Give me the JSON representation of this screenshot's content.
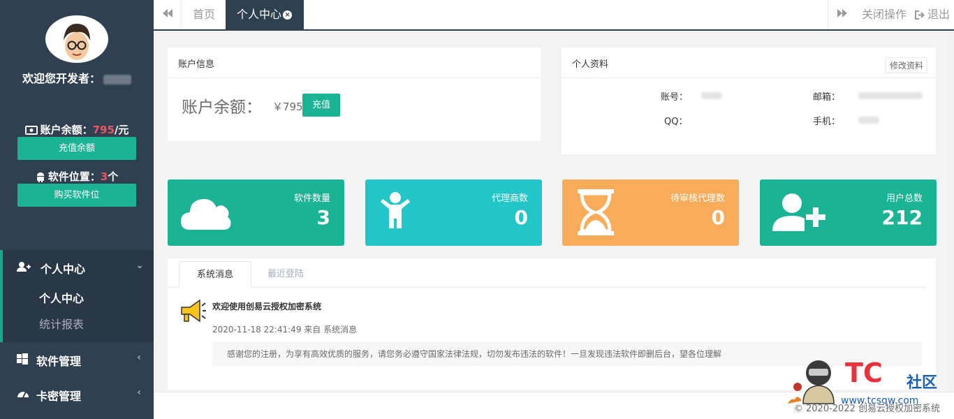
{
  "sidebar": {
    "welcome_label": "欢迎您开发者：",
    "balance": {
      "prefix": "账户余额：",
      "amount": "795",
      "suffix": "/元",
      "button": "充值余额"
    },
    "software": {
      "prefix": "软件位置：",
      "amount": "3",
      "suffix": "个",
      "button": "购买软件位"
    },
    "nav": [
      {
        "label": "个人中心",
        "icon": "user-plus-icon",
        "active": true,
        "children": [
          {
            "label": "个人中心",
            "active": true
          },
          {
            "label": "统计报表",
            "active": false
          }
        ]
      },
      {
        "label": "软件管理",
        "icon": "windows-icon"
      },
      {
        "label": "卡密管理",
        "icon": "dashboard-icon"
      }
    ]
  },
  "topbar": {
    "tabs": [
      {
        "label": "首页"
      },
      {
        "label": "个人中心",
        "active": true
      }
    ],
    "close_ops": "关闭操作",
    "logout": "退出"
  },
  "account_panel": {
    "title": "账户信息",
    "balance_label": "账户余额：",
    "balance_value": "￥795",
    "recharge": "充值"
  },
  "profile_panel": {
    "title": "个人资料",
    "edit": "修改资料",
    "fields": {
      "account": "账号：",
      "email": "邮箱：",
      "qq": "QQ：",
      "phone": "手机："
    }
  },
  "stats": [
    {
      "title": "软件数量",
      "value": "3",
      "color": "#1ab394",
      "icon": "cloud-icon"
    },
    {
      "title": "代理商数",
      "value": "0",
      "color": "#23c6c8",
      "icon": "child-icon"
    },
    {
      "title": "待审核代理数",
      "value": "0",
      "color": "#f8ac59",
      "icon": "hourglass-icon"
    },
    {
      "title": "用户总数",
      "value": "212",
      "color": "#1ab394",
      "icon": "user-add-icon"
    }
  ],
  "messages": {
    "tabs": [
      {
        "label": "系统消息",
        "active": true
      },
      {
        "label": "最近登陆"
      }
    ],
    "item": {
      "title": "欢迎使用创易云授权加密系统",
      "meta": "2020-11-18 22:41:49 来自 系统消息",
      "body": "感谢您的注册，为享有高效优质的服务，请您务必遵守国家法律法规，切勿发布违法的软件！一旦发现违法软件即删后台，望各位理解"
    }
  },
  "footer": {
    "text": "© 2020-2022 创易云授权加密系统"
  },
  "watermark": {
    "logo": "TC",
    "community": "社区",
    "url": "www.tcsqw.com"
  }
}
